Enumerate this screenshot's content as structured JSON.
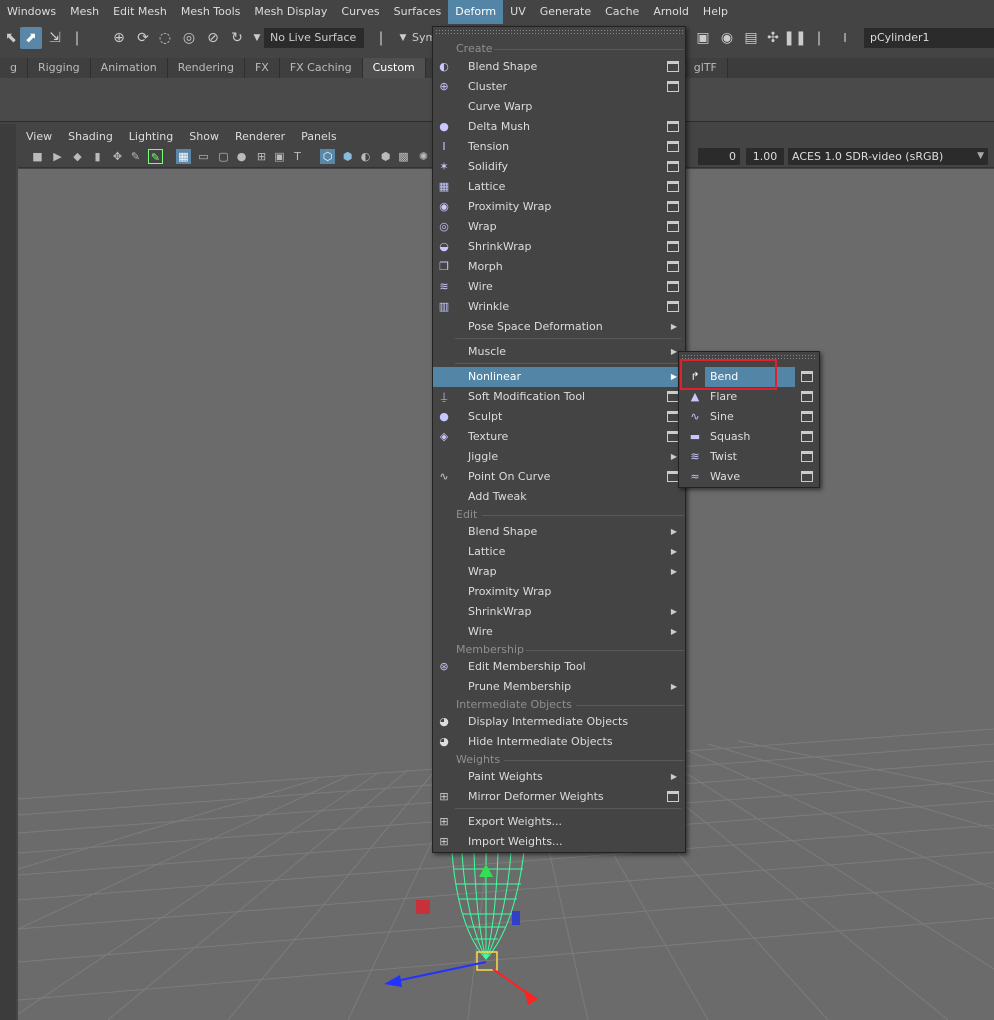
{
  "menubar": {
    "items": [
      "Windows",
      "Mesh",
      "Edit Mesh",
      "Mesh Tools",
      "Mesh Display",
      "Curves",
      "Surfaces",
      "Deform",
      "UV",
      "Generate",
      "Cache",
      "Arnold",
      "Help"
    ],
    "active": "Deform"
  },
  "toolline": {
    "live_surface": "No Live Surface",
    "symmetry_label": "Sym",
    "object_name": "pCylinder1"
  },
  "shelf": {
    "tabs": [
      "g",
      "Rigging",
      "Animation",
      "Rendering",
      "FX",
      "FX Caching",
      "Custom",
      "glTF"
    ],
    "active": "Custom"
  },
  "panel": {
    "menus": [
      "View",
      "Shading",
      "Lighting",
      "Show",
      "Renderer",
      "Panels"
    ],
    "exposure": "0",
    "gamma": "1.00",
    "color_space": "ACES 1.0 SDR-video (sRGB)"
  },
  "deform_menu": {
    "sections": {
      "create": "Create",
      "edit": "Edit",
      "membership": "Membership",
      "intermediate": "Intermediate Objects",
      "weights": "Weights"
    },
    "create_items": [
      {
        "label": "Blend Shape",
        "icon": "blend-shape-icon",
        "option": true
      },
      {
        "label": "Cluster",
        "icon": "cluster-icon",
        "option": true
      },
      {
        "label": "Curve Warp",
        "icon": "",
        "option": false
      },
      {
        "label": "Delta Mush",
        "icon": "delta-mush-icon",
        "option": true
      },
      {
        "label": "Tension",
        "icon": "tension-icon",
        "option": true
      },
      {
        "label": "Solidify",
        "icon": "solidify-icon",
        "option": true
      },
      {
        "label": "Lattice",
        "icon": "lattice-icon",
        "option": true
      },
      {
        "label": "Proximity Wrap",
        "icon": "proximity-wrap-icon",
        "option": true
      },
      {
        "label": "Wrap",
        "icon": "wrap-icon",
        "option": true
      },
      {
        "label": "ShrinkWrap",
        "icon": "shrinkwrap-icon",
        "option": true
      },
      {
        "label": "Morph",
        "icon": "morph-icon",
        "option": true
      },
      {
        "label": "Wire",
        "icon": "wire-icon",
        "option": true
      },
      {
        "label": "Wrinkle",
        "icon": "wrinkle-icon",
        "option": true
      },
      {
        "label": "Pose Space Deformation",
        "icon": "",
        "submenu": true
      }
    ],
    "muscle": "Muscle",
    "nonlinear": "Nonlinear",
    "tool_items": [
      {
        "label": "Soft Modification Tool",
        "option": true
      },
      {
        "label": "Sculpt",
        "option": true
      },
      {
        "label": "Texture",
        "option": true
      },
      {
        "label": "Jiggle",
        "submenu": true
      },
      {
        "label": "Point On Curve",
        "option": true
      },
      {
        "label": "Add Tweak"
      }
    ],
    "edit_items": [
      {
        "label": "Blend Shape",
        "submenu": true
      },
      {
        "label": "Lattice",
        "submenu": true
      },
      {
        "label": "Wrap",
        "submenu": true
      },
      {
        "label": "Proximity Wrap"
      },
      {
        "label": "ShrinkWrap",
        "submenu": true
      },
      {
        "label": "Wire",
        "submenu": true
      }
    ],
    "membership_items": [
      {
        "label": "Edit Membership Tool"
      },
      {
        "label": "Prune Membership",
        "submenu": true
      }
    ],
    "intermediate_items": [
      {
        "label": "Display Intermediate Objects"
      },
      {
        "label": "Hide Intermediate Objects"
      }
    ],
    "weights_items": [
      {
        "label": "Paint Weights",
        "submenu": true
      },
      {
        "label": "Mirror Deformer Weights",
        "option": true
      },
      {
        "label": "Export Weights..."
      },
      {
        "label": "Import Weights..."
      }
    ]
  },
  "nonlinear_menu": {
    "items": [
      {
        "label": "Bend",
        "icon": "bend-icon",
        "highlighted": true
      },
      {
        "label": "Flare",
        "icon": "flare-icon"
      },
      {
        "label": "Sine",
        "icon": "sine-icon"
      },
      {
        "label": "Squash",
        "icon": "squash-icon"
      },
      {
        "label": "Twist",
        "icon": "twist-icon"
      },
      {
        "label": "Wave",
        "icon": "wave-icon"
      }
    ]
  },
  "colors": {
    "menu_highlight": "#5285a6",
    "callout": "#e0202a",
    "wireframe": "#40ff9f"
  }
}
